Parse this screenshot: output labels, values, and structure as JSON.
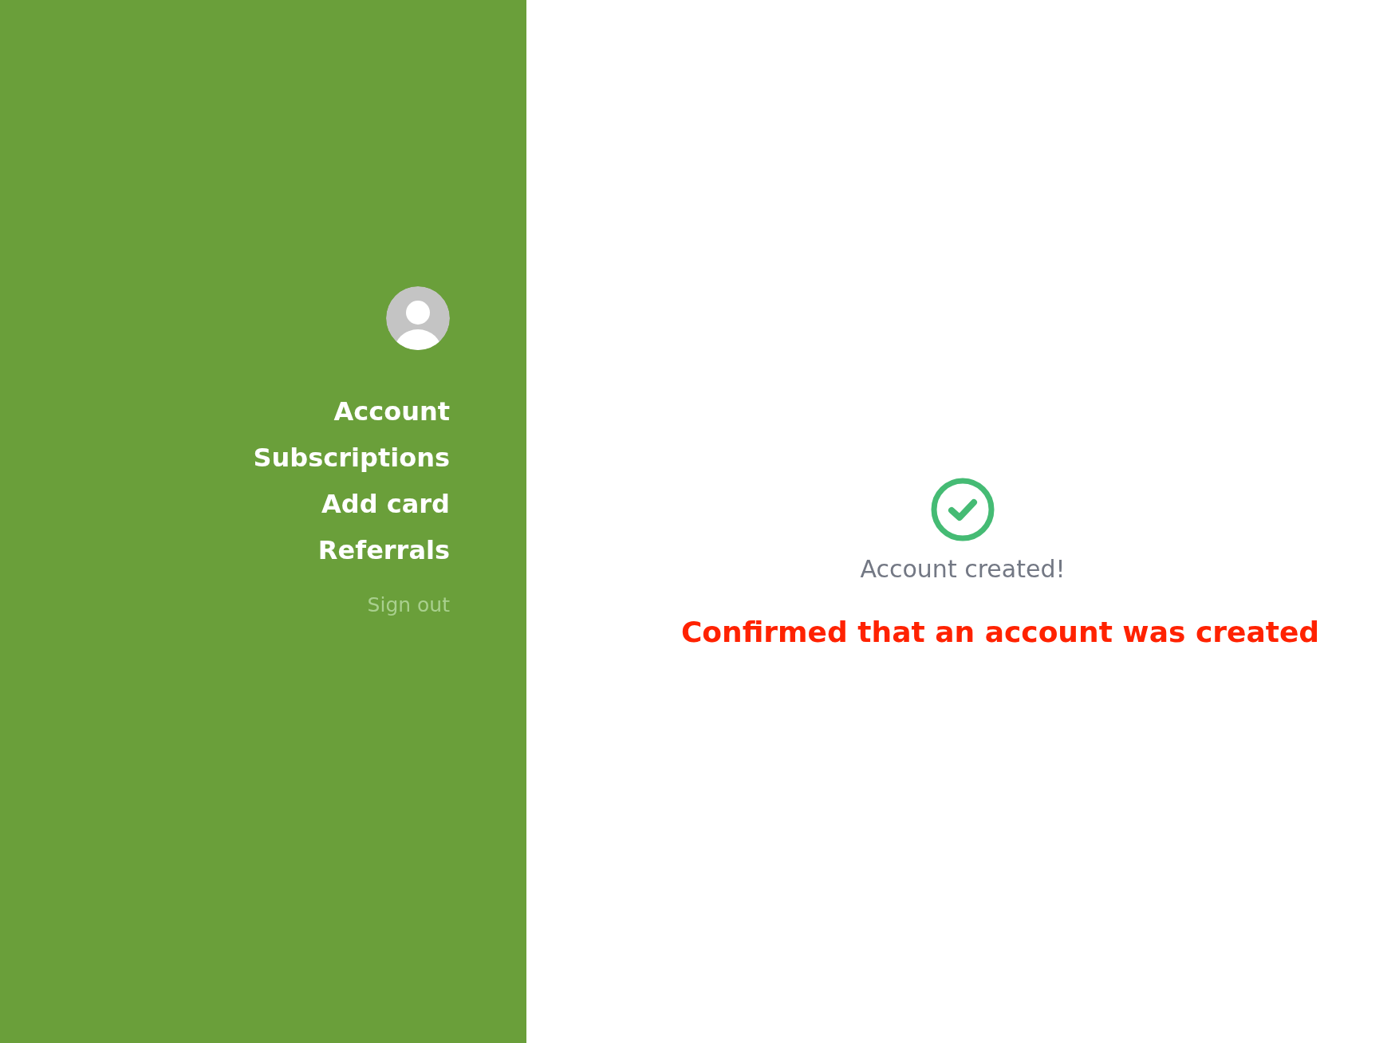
{
  "sidebar": {
    "items": [
      {
        "label": "Account",
        "kind": "link"
      },
      {
        "label": "Subscriptions",
        "kind": "link"
      },
      {
        "label": "Add card",
        "kind": "link"
      },
      {
        "label": "Referrals",
        "kind": "link"
      },
      {
        "label": "Sign out",
        "kind": "muted"
      }
    ]
  },
  "main": {
    "message": "Account created!",
    "annotation": "Confirmed that an account was created"
  }
}
